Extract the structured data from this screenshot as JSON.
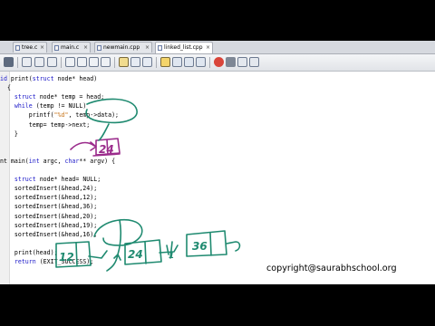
{
  "tabs": [
    {
      "label": "tree.c",
      "active": false
    },
    {
      "label": "main.c",
      "active": false
    },
    {
      "label": "newmain.cpp",
      "active": false
    },
    {
      "label": "linked_list.cpp",
      "active": true
    }
  ],
  "code_lines": [
    [
      {
        "t": "id ",
        "c": "kw"
      },
      {
        "t": "print(",
        "c": ""
      },
      {
        "t": "struct",
        "c": "kw"
      },
      {
        "t": " node* head)",
        "c": ""
      }
    ],
    [
      {
        "t": "  {",
        "c": ""
      }
    ],
    [
      {
        "t": "    ",
        "c": ""
      },
      {
        "t": "struct",
        "c": "kw"
      },
      {
        "t": " node* temp = head;",
        "c": ""
      }
    ],
    [
      {
        "t": "    ",
        "c": ""
      },
      {
        "t": "while",
        "c": "kw"
      },
      {
        "t": " (temp != NULL)",
        "c": ""
      }
    ],
    [
      {
        "t": "        printf(",
        "c": ""
      },
      {
        "t": "\"%d\"",
        "c": "str"
      },
      {
        "t": ", temp->data);",
        "c": ""
      }
    ],
    [
      {
        "t": "        temp= temp->next;",
        "c": ""
      }
    ],
    [
      {
        "t": "    }",
        "c": ""
      }
    ],
    [
      {
        "t": "",
        "c": ""
      }
    ],
    [
      {
        "t": "",
        "c": ""
      }
    ],
    [
      {
        "t": "nt main(",
        "c": ""
      },
      {
        "t": "int",
        "c": "kw"
      },
      {
        "t": " argc, ",
        "c": ""
      },
      {
        "t": "char",
        "c": "kw"
      },
      {
        "t": "** argv) {",
        "c": ""
      }
    ],
    [
      {
        "t": "",
        "c": ""
      }
    ],
    [
      {
        "t": "    ",
        "c": ""
      },
      {
        "t": "struct",
        "c": "kw"
      },
      {
        "t": " node* head= NULL;",
        "c": ""
      }
    ],
    [
      {
        "t": "    sortedInsert(&head,24);",
        "c": ""
      }
    ],
    [
      {
        "t": "    sortedInsert(&head,12);",
        "c": ""
      }
    ],
    [
      {
        "t": "    sortedInsert(&head,36);",
        "c": ""
      }
    ],
    [
      {
        "t": "    sortedInsert(&head,20);",
        "c": ""
      }
    ],
    [
      {
        "t": "    sortedInsert(&head,19);",
        "c": ""
      }
    ],
    [
      {
        "t": "    sortedInsert(&head,16);",
        "c": ""
      }
    ],
    [
      {
        "t": "",
        "c": ""
      }
    ],
    [
      {
        "t": "    print(head);",
        "c": ""
      }
    ],
    [
      {
        "t": "    ",
        "c": ""
      },
      {
        "t": "return",
        "c": "kw"
      },
      {
        "t": " (EXIT_SUCCESS);",
        "c": ""
      }
    ]
  ],
  "annotations": {
    "node_temp": "24",
    "node_1": "12",
    "node_2": "24",
    "node_3": "36",
    "pointer_mark": "1"
  },
  "copyright": "copyright@saurabhschool.org",
  "colors": {
    "keyword": "#1b18c8",
    "string": "#c8751b",
    "ink_green": "#1f8a70",
    "ink_purple": "#9b2c8c"
  }
}
